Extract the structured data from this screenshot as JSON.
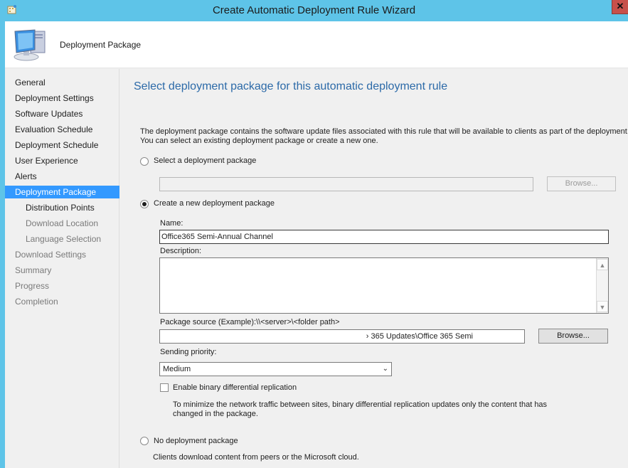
{
  "window": {
    "title": "Create Automatic Deployment Rule Wizard",
    "close_glyph": "✕",
    "icons": {
      "app": "wizard-app-icon",
      "header": "computer-monitor-icon",
      "close": "close-icon"
    }
  },
  "header": {
    "title": "Deployment Package"
  },
  "sidebar": {
    "items": [
      {
        "label": "General",
        "level": 0,
        "state": "normal"
      },
      {
        "label": "Deployment Settings",
        "level": 0,
        "state": "normal"
      },
      {
        "label": "Software Updates",
        "level": 0,
        "state": "normal"
      },
      {
        "label": "Evaluation Schedule",
        "level": 0,
        "state": "normal"
      },
      {
        "label": "Deployment Schedule",
        "level": 0,
        "state": "normal"
      },
      {
        "label": "User Experience",
        "level": 0,
        "state": "normal"
      },
      {
        "label": "Alerts",
        "level": 0,
        "state": "normal"
      },
      {
        "label": "Deployment Package",
        "level": 0,
        "state": "active"
      },
      {
        "label": "Distribution Points",
        "level": 1,
        "state": "normal"
      },
      {
        "label": "Download Location",
        "level": 1,
        "state": "dim"
      },
      {
        "label": "Language Selection",
        "level": 1,
        "state": "dim"
      },
      {
        "label": "Download Settings",
        "level": 0,
        "state": "dim"
      },
      {
        "label": "Summary",
        "level": 0,
        "state": "dim"
      },
      {
        "label": "Progress",
        "level": 0,
        "state": "dim"
      },
      {
        "label": "Completion",
        "level": 0,
        "state": "dim"
      }
    ]
  },
  "main": {
    "title": "Select deployment package for this automatic deployment rule",
    "intro_line1": "The deployment package contains the software update files associated with this rule that will be available to clients as part of the deployment.",
    "intro_line2": "You can select an existing deployment package or create a new one.",
    "option_existing": {
      "label": "Select a deployment package",
      "selected": false,
      "value": "",
      "browse_label": "Browse..."
    },
    "option_new": {
      "label": "Create a new deployment package",
      "selected": true,
      "name_label": "Name:",
      "name_value": "Office365 Semi-Annual Channel",
      "description_label": "Description:",
      "description_value": "",
      "source_label": "Package source (Example):\\\\<server>\\<folder path>",
      "source_value": "› 365 Updates\\Office 365 Semi",
      "browse_label": "Browse...",
      "priority_label": "Sending priority:",
      "priority_value": "Medium",
      "bdr_label": "Enable binary differential replication",
      "bdr_checked": false,
      "bdr_note_line1": "To minimize the network traffic between sites, binary differential replication updates only the content that has",
      "bdr_note_line2": "changed in the package."
    },
    "option_none": {
      "label": "No deployment package",
      "selected": false,
      "note": "Clients download content from peers or the Microsoft cloud."
    },
    "scroll_up": "▲",
    "scroll_down": "▼",
    "select_chevron": "⌄"
  }
}
